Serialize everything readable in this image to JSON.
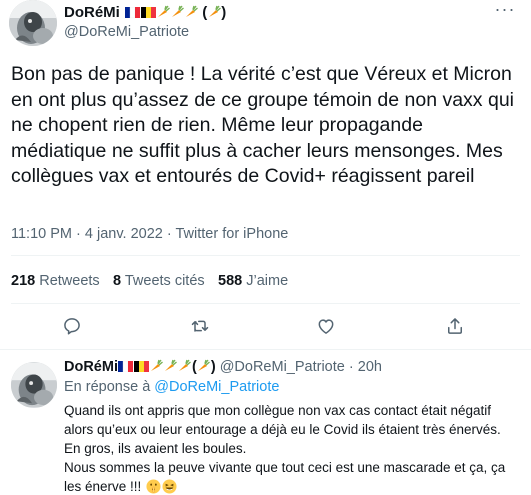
{
  "tweet": {
    "author_name": "DoRéMi",
    "name_suffix": "(",
    "name_suffix_close": ")",
    "handle": "@DoReMi_Patriote",
    "more_label": "···",
    "text": "Bon pas de panique ! La vérité c’est que Véreux et Micron en ont plus qu’assez de ce groupe témoin de non vaxx qui ne chopent rien de rien. Même leur propagande médiatique ne suffit plus à cacher leurs mensonges. Mes collègues vax et entourés de Covid+ réagissent pareil",
    "time": "11:10 PM",
    "sep": "·",
    "date": "4 janv. 2022",
    "source": "Twitter for iPhone",
    "stats": {
      "retweets_count": "218",
      "retweets_label": "Retweets",
      "quotes_count": "8",
      "quotes_label": "Tweets cités",
      "likes_count": "588",
      "likes_label": "J’aime"
    },
    "actions": [
      "reply-icon",
      "retweet-icon",
      "like-icon",
      "share-icon"
    ]
  },
  "reply": {
    "author_name": "DoRéMi",
    "name_suffix": "(",
    "name_suffix_close": ")",
    "handle": "@DoReMi_Patriote",
    "sep": "·",
    "time": "20h",
    "replying_prefix": "En réponse à ",
    "replying_mention": "@DoReMi_Patriote",
    "text_line1": "Quand ils ont appris que mon collègue non vax cas contact était négatif alors qu’eux ou leur entourage a déjà eu le Covid ils étaient très énervés. En gros, ils avaient les boules.",
    "text_line2": "Nous sommes la peuve vivante que tout ceci est une mascarade et ça, ça les énerve !!! "
  },
  "colors": {
    "text": "#0f1419",
    "secondary": "#536471",
    "accent": "#1d9bf0",
    "divider": "#eff3f4",
    "flag_fr": [
      "#002395",
      "#ffffff",
      "#ed2939"
    ],
    "flag_be": [
      "#000000",
      "#fdda24",
      "#ef3340"
    ],
    "carrot": "#f4900c"
  },
  "name_emojis": [
    "flag-france-icon",
    "flag-belgium-icon",
    "carrot-icon",
    "carrot-icon",
    "carrot-icon",
    "carrot-icon"
  ],
  "reply_emojis": [
    "shushing-face-icon",
    "laughing-face-icon"
  ]
}
